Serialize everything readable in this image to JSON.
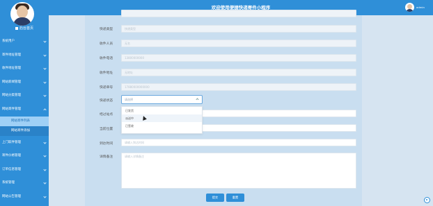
{
  "header": {
    "title": "欢迎使用便捷快递寄件小程序",
    "user_name": "admin"
  },
  "sidebar": {
    "home": "后台首页",
    "items": [
      {
        "label": "系统用户",
        "open": false
      },
      {
        "label": "寄件地址管理",
        "open": false
      },
      {
        "label": "收件地址管理",
        "open": false
      },
      {
        "label": "网站新闻管理",
        "open": false
      },
      {
        "label": "网站分类管理",
        "open": false
      },
      {
        "label": "网站寄件管理",
        "open": true,
        "subs": [
          "网站寄件列表",
          "网站寄件添加"
        ]
      },
      {
        "label": "上门取件管理",
        "open": false
      },
      {
        "label": "寄件价格管理",
        "open": false
      },
      {
        "label": "订单信息管理",
        "open": false
      },
      {
        "label": "系统管理",
        "open": false
      },
      {
        "label": "网站公告管理",
        "open": false
      }
    ]
  },
  "form": {
    "fields": [
      {
        "label": "快递类型",
        "placeholder": "快递类型"
      },
      {
        "label": "收件人员",
        "placeholder": "无名"
      },
      {
        "label": "收件电话",
        "placeholder": "13800000000"
      },
      {
        "label": "收件地址",
        "placeholder": "无地址"
      },
      {
        "label": "快递单号",
        "placeholder": "17880000000000"
      }
    ],
    "status_label": "快递状态",
    "status_placeholder": "请选择",
    "status_options": [
      "已发货",
      "派送中",
      "已签收"
    ],
    "station_label": "经过站点",
    "location_label": "当前位置",
    "arrive_label": "到达时间",
    "arrive_placeholder": "请输入到达时间",
    "remark_label": "详情备注",
    "remark_placeholder": "请输入详情备注",
    "submit": "提交",
    "reset": "重置"
  },
  "colors": {
    "accent": "#2f8fd8"
  }
}
